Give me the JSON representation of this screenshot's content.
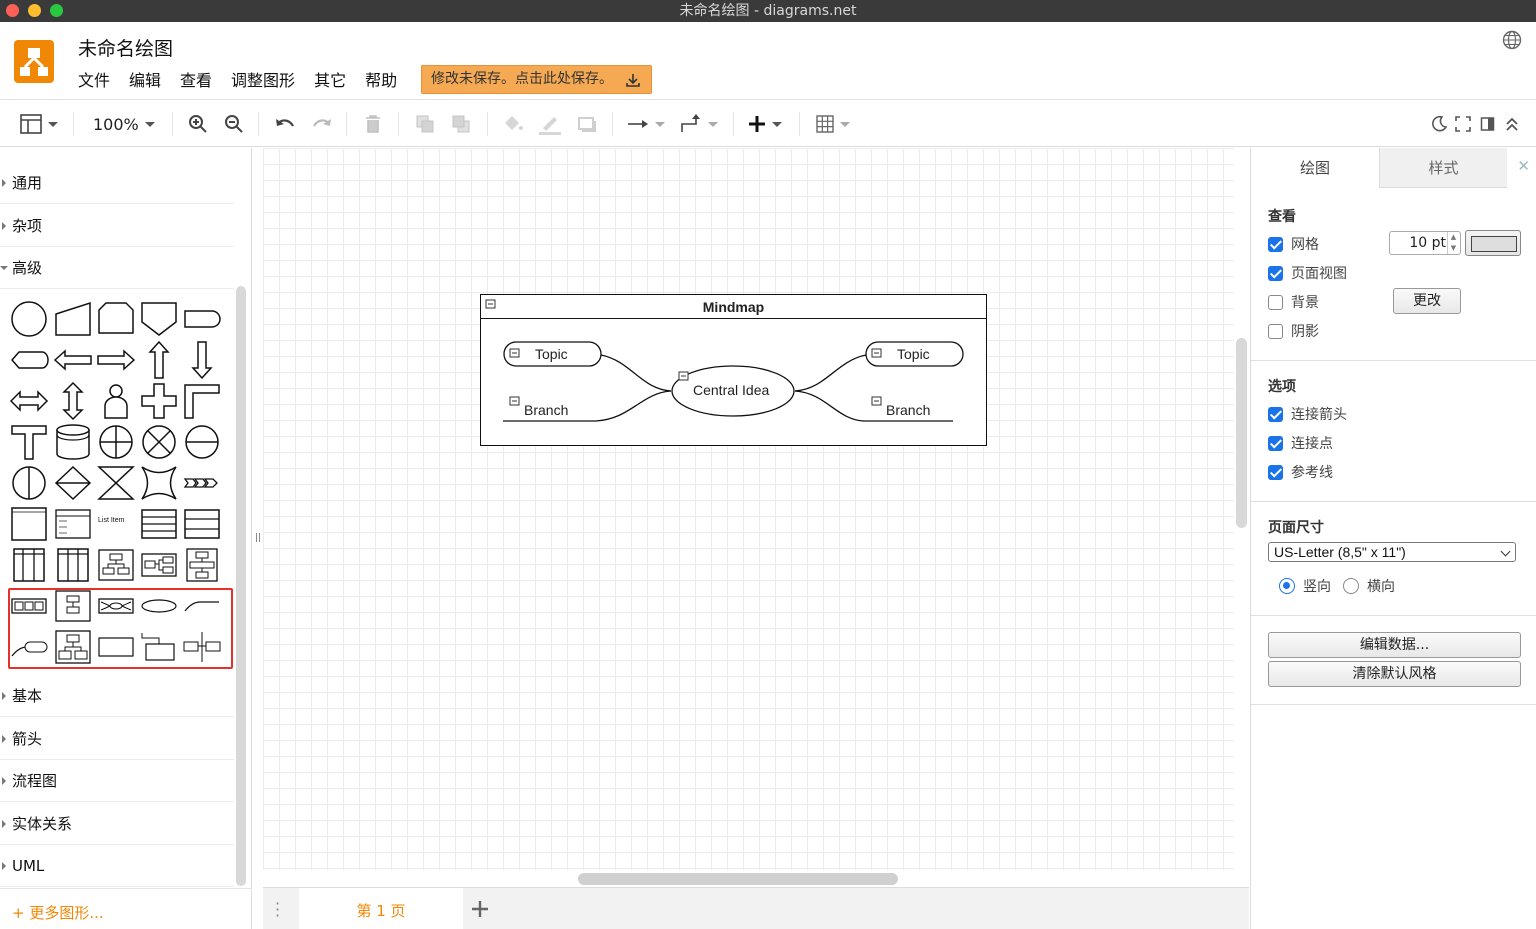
{
  "window": {
    "title": "未命名绘图 - diagrams.net"
  },
  "header": {
    "doc_title": "未命名绘图",
    "menu": [
      "文件",
      "编辑",
      "查看",
      "调整图形",
      "其它",
      "帮助"
    ],
    "save_banner": "修改未保存。点击此处保存。"
  },
  "toolbar": {
    "zoom": "100%"
  },
  "sidebar": {
    "top_categories": [
      "通用",
      "杂项",
      "高级"
    ],
    "bottom_categories": [
      "基本",
      "箭头",
      "流程图",
      "实体关系",
      "UML"
    ],
    "more_shapes": "+ 更多图形...",
    "shape_labels": {
      "list_item": "List Item"
    }
  },
  "diagram": {
    "title": "Mindmap",
    "center": "Central Idea",
    "topic_left": "Topic",
    "topic_right": "Topic",
    "branch_left": "Branch",
    "branch_right": "Branch"
  },
  "pages": {
    "current": "第 1 页"
  },
  "panel": {
    "tabs": [
      "绘图",
      "样式"
    ],
    "view_title": "查看",
    "view_options": [
      {
        "label": "网格",
        "checked": true
      },
      {
        "label": "页面视图",
        "checked": true
      },
      {
        "label": "背景",
        "checked": false
      },
      {
        "label": "阴影",
        "checked": false
      }
    ],
    "grid_size": "10 pt",
    "change_button": "更改",
    "options_title": "选项",
    "options": [
      {
        "label": "连接箭头",
        "checked": true
      },
      {
        "label": "连接点",
        "checked": true
      },
      {
        "label": "参考线",
        "checked": true
      }
    ],
    "page_size_title": "页面尺寸",
    "page_size": "US-Letter (8,5\" x 11\")",
    "orientation": {
      "portrait": "竖向",
      "landscape": "横向",
      "selected": "portrait"
    },
    "edit_data_button": "编辑数据...",
    "clear_style_button": "清除默认风格"
  },
  "colors": {
    "accent": "#f08705",
    "check": "#1a73e8",
    "highlight": "#e5312b"
  }
}
